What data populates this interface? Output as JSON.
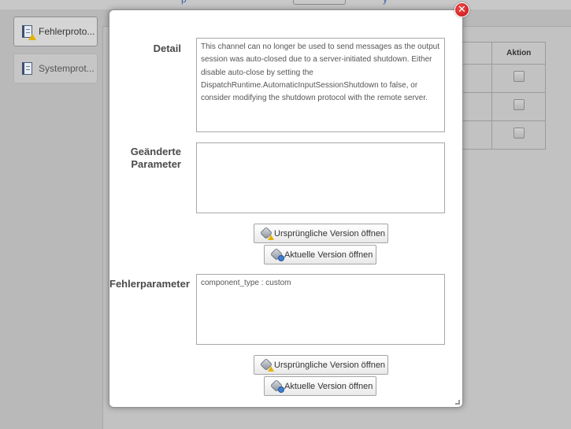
{
  "background": {
    "top_link_1": "p",
    "top_link_2": "y",
    "sidebar": [
      {
        "label": "Fehlerproto...",
        "icon": "error-log-icon"
      },
      {
        "label": "Systemprot...",
        "icon": "system-log-icon"
      }
    ],
    "table": {
      "header_action": "Aktion",
      "rows": 3
    }
  },
  "modal": {
    "close_symbol": "✕",
    "detail_label": "Detail",
    "detail_text": "This channel can no longer be used to send messages as the output session was auto-closed due to a server-initiated shutdown. Either disable auto-close by setting the DispatchRuntime.AutomaticInputSessionShutdown to false, or consider modifying the shutdown protocol with the remote server.",
    "changed_params_label_line1": "Geänderte",
    "changed_params_label_line2": "Parameter",
    "changed_params_text": "",
    "open_original_label": "Ursprüngliche Version öffnen",
    "open_current_label": "Aktuelle Version öffnen",
    "error_params_label": "Fehlerparameter",
    "error_params_text": "component_type : custom",
    "open_original_label_2": "Ursprüngliche Version öffnen",
    "open_current_label_2": "Aktuelle Version öffnen"
  }
}
